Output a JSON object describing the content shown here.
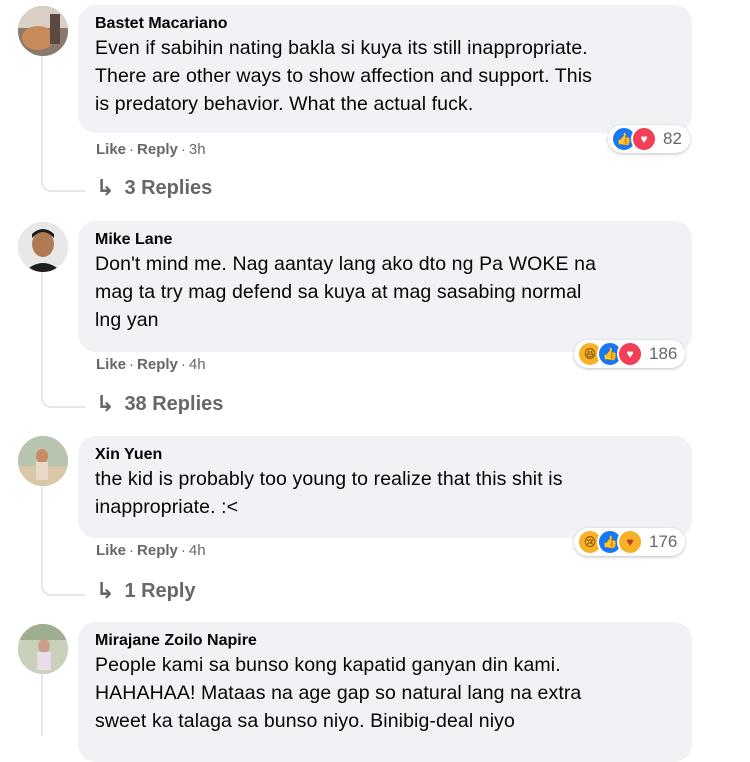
{
  "comments": [
    {
      "author": "Bastet Macariano",
      "text": "Even if sabihin nating bakla si kuya its still inappropriate.\nThere are other ways to show affection and support. This\nis predatory behavior. What the actual fuck.",
      "like": "Like",
      "reply": "Reply",
      "time": "3h",
      "reaction_count": "82",
      "reactions": [
        "like-icon",
        "love-icon"
      ],
      "replies": "3 Replies"
    },
    {
      "author": "Mike Lane",
      "text": "Don't mind me. Nag aantay lang ako dto ng Pa WOKE na\nmag ta try mag defend sa kuya at mag sasabing normal\nlng yan",
      "like": "Like",
      "reply": "Reply",
      "time": "4h",
      "reaction_count": "186",
      "reactions": [
        "haha-icon",
        "like-icon",
        "love-icon"
      ],
      "replies": "38 Replies"
    },
    {
      "author": "Xin Yuen",
      "text": "the kid is probably too young to realize that this shit is\ninappropriate. :<",
      "like": "Like",
      "reply": "Reply",
      "time": "4h",
      "reaction_count": "176",
      "reactions": [
        "sad-icon",
        "like-icon",
        "care-icon"
      ],
      "replies": "1 Reply"
    },
    {
      "author": "Mirajane Zoilo Napire",
      "text": "People kami sa bunso kong kapatid ganyan din kami.\nHAHAHAA! Mataas na age gap so natural lang na extra\nsweet ka talaga sa bunso niyo. Binibig-deal niyo"
    }
  ],
  "dot": "·",
  "colors": {
    "bubble": "#f0f2f5",
    "meta": "#65676b",
    "like": "#1877f2",
    "love": "#f33e58",
    "emoji": "#f7b125"
  }
}
